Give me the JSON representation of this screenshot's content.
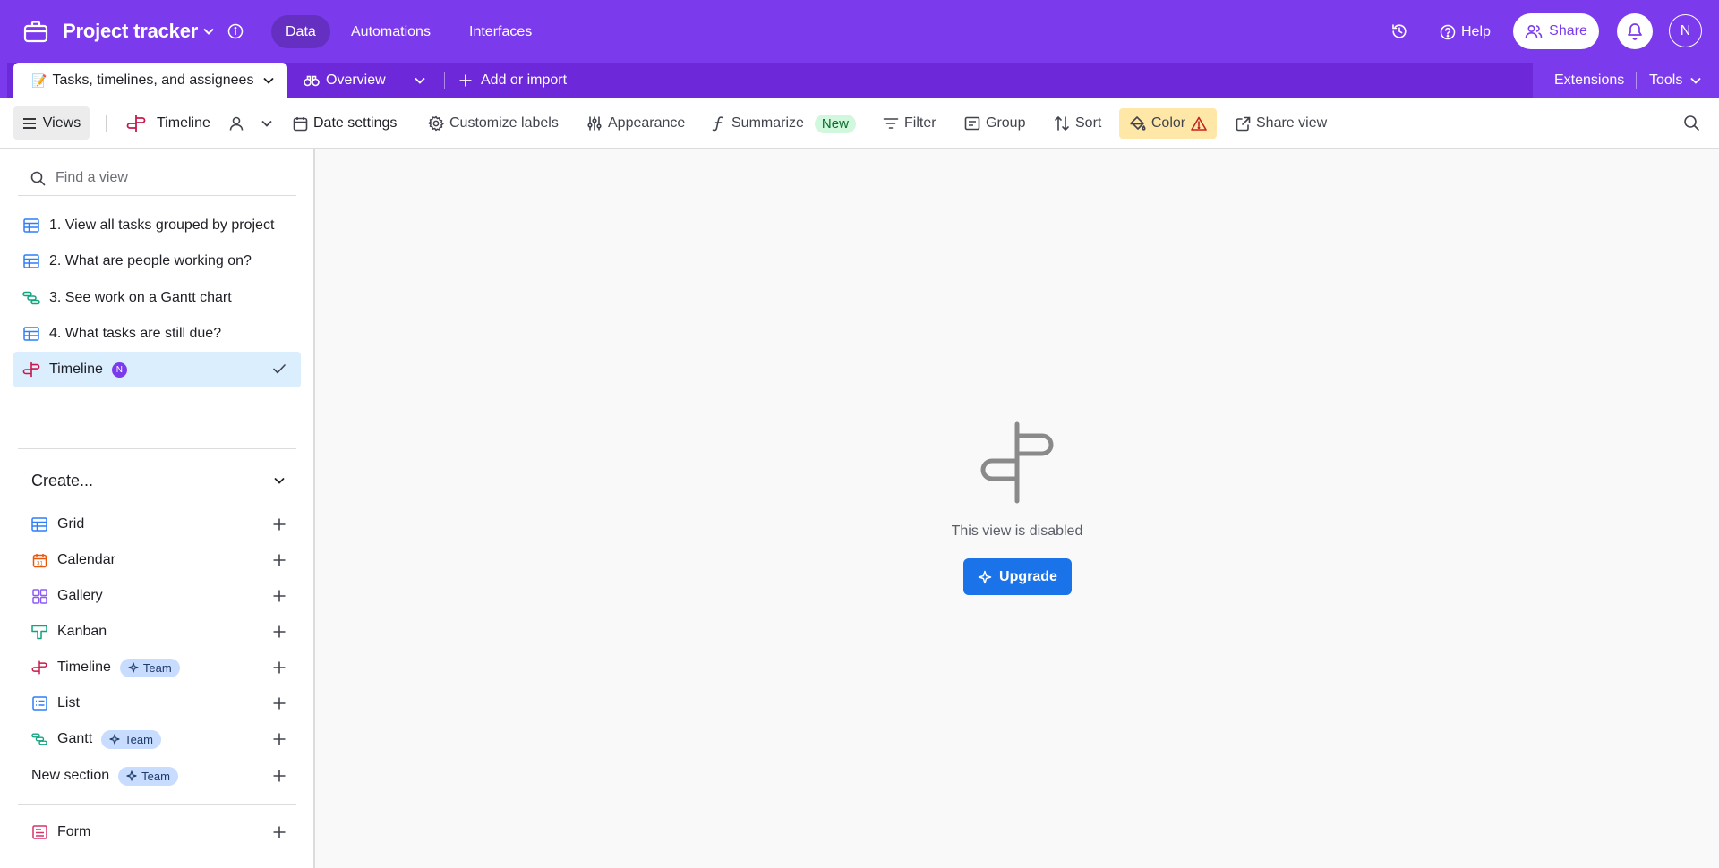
{
  "header": {
    "base_name": "Project tracker",
    "nav": [
      "Data",
      "Automations",
      "Interfaces"
    ],
    "help_label": "Help",
    "share_label": "Share",
    "avatar_initial": "N",
    "brand_color": "#7c3aed"
  },
  "tabs": {
    "table_emoji": "📝",
    "table_name": "Tasks, timelines, and assignees",
    "overview_label": "Overview",
    "add_import_label": "Add or import",
    "extensions_label": "Extensions",
    "tools_label": "Tools"
  },
  "toolbar": {
    "views_label": "Views",
    "current_view": "Timeline",
    "date_settings": "Date settings",
    "customize_labels": "Customize labels",
    "appearance": "Appearance",
    "summarize": "Summarize",
    "new_badge": "New",
    "filter": "Filter",
    "group": "Group",
    "sort": "Sort",
    "color": "Color",
    "share_view": "Share view"
  },
  "sidebar": {
    "find_placeholder": "Find a view",
    "views": [
      {
        "label": "1. View all tasks grouped by project",
        "icon": "grid-icon"
      },
      {
        "label": "2. What are people working on?",
        "icon": "grid-icon"
      },
      {
        "label": "3. See work on a Gantt chart",
        "icon": "gantt-icon"
      },
      {
        "label": "4. What tasks are still due?",
        "icon": "grid-icon"
      },
      {
        "label": "Timeline",
        "icon": "timeline-icon",
        "owner_initial": "N",
        "active": true
      }
    ],
    "create_label": "Create...",
    "create_items": [
      {
        "label": "Grid",
        "icon": "grid-icon"
      },
      {
        "label": "Calendar",
        "icon": "calendar-icon"
      },
      {
        "label": "Gallery",
        "icon": "gallery-icon"
      },
      {
        "label": "Kanban",
        "icon": "kanban-icon"
      },
      {
        "label": "Timeline",
        "icon": "timeline-icon",
        "badge": "Team"
      },
      {
        "label": "List",
        "icon": "list-icon"
      },
      {
        "label": "Gantt",
        "icon": "gantt-icon",
        "badge": "Team"
      },
      {
        "label": "New section",
        "badge": "Team"
      },
      {
        "label": "Form",
        "icon": "form-icon"
      }
    ]
  },
  "main": {
    "disabled_message": "This view is disabled",
    "upgrade_label": "Upgrade"
  }
}
